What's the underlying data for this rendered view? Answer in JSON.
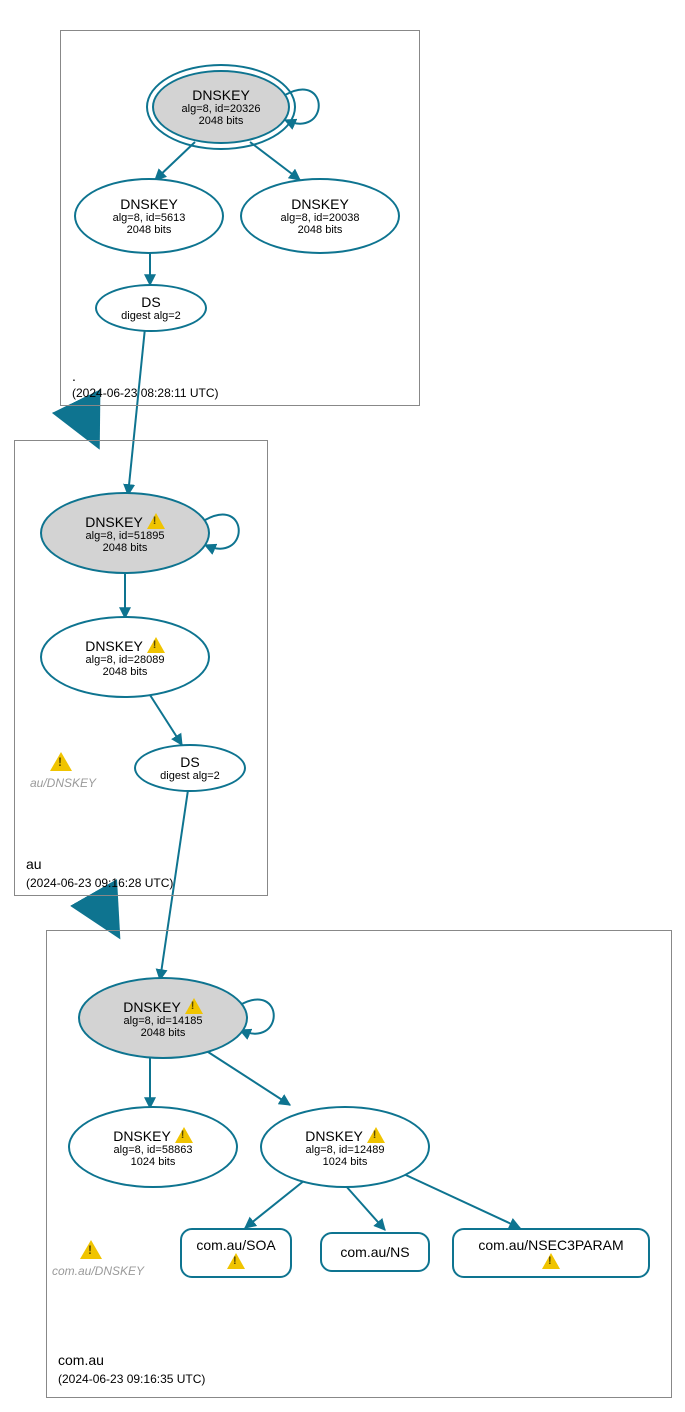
{
  "zones": {
    "root": {
      "label": ".",
      "timestamp": "(2024-06-23 08:28:11 UTC)"
    },
    "au": {
      "label": "au",
      "timestamp": "(2024-06-23 09:16:28 UTC)"
    },
    "comau": {
      "label": "com.au",
      "timestamp": "(2024-06-23 09:16:35 UTC)"
    }
  },
  "nodes": {
    "root_ksk": {
      "title": "DNSKEY",
      "line1": "alg=8, id=20326",
      "line2": "2048 bits"
    },
    "root_zsk1": {
      "title": "DNSKEY",
      "line1": "alg=8, id=5613",
      "line2": "2048 bits"
    },
    "root_zsk2": {
      "title": "DNSKEY",
      "line1": "alg=8, id=20038",
      "line2": "2048 bits"
    },
    "root_ds": {
      "title": "DS",
      "line1": "digest alg=2"
    },
    "au_ksk": {
      "title": "DNSKEY",
      "line1": "alg=8, id=51895",
      "line2": "2048 bits"
    },
    "au_zsk": {
      "title": "DNSKEY",
      "line1": "alg=8, id=28089",
      "line2": "2048 bits"
    },
    "au_ds": {
      "title": "DS",
      "line1": "digest alg=2"
    },
    "comau_ksk": {
      "title": "DNSKEY",
      "line1": "alg=8, id=14185",
      "line2": "2048 bits"
    },
    "comau_zsk1": {
      "title": "DNSKEY",
      "line1": "alg=8, id=58863",
      "line2": "1024 bits"
    },
    "comau_zsk2": {
      "title": "DNSKEY",
      "line1": "alg=8, id=12489",
      "line2": "1024 bits"
    },
    "comau_soa": {
      "title": "com.au/SOA"
    },
    "comau_ns": {
      "title": "com.au/NS"
    },
    "comau_nsec": {
      "title": "com.au/NSEC3PARAM"
    }
  },
  "warn_labels": {
    "au": "au/DNSKEY",
    "comau": "com.au/DNSKEY"
  }
}
